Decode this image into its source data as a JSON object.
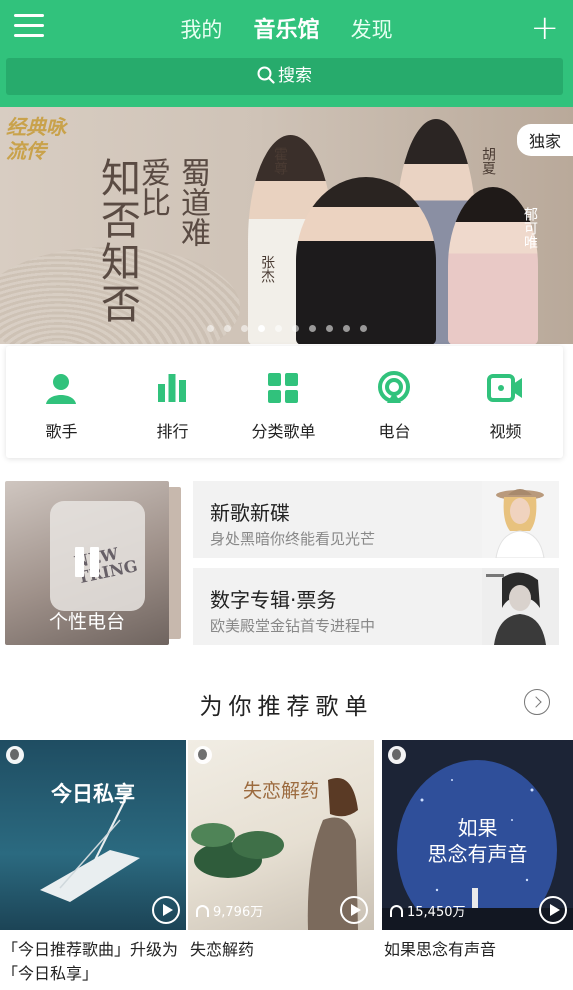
{
  "header": {
    "tabs": [
      {
        "label": "我的"
      },
      {
        "label": "音乐馆"
      },
      {
        "label": "发现"
      }
    ],
    "active_tab": "音乐馆",
    "plus_icon": "plus-icon",
    "menu_icon": "hamburger-menu-icon",
    "search": {
      "label": "搜索",
      "icon": "search-icon"
    },
    "colors": {
      "brand": "#31c27c",
      "search_bg": "#27ab6c"
    }
  },
  "banner": {
    "show_logo": "经典咏流传",
    "poem_lines": [
      "知否知否",
      "爱比",
      "蜀道难"
    ],
    "artists": [
      "霍尊",
      "胡夏",
      "张杰",
      "郁可唯"
    ],
    "exclusive_label": "独家",
    "page_count": 10,
    "active_page": 4
  },
  "shortcuts": [
    {
      "label": "歌手",
      "icon": "singer-icon"
    },
    {
      "label": "排行",
      "icon": "ranking-bars-icon"
    },
    {
      "label": "分类歌单",
      "icon": "category-grid-icon"
    },
    {
      "label": "电台",
      "icon": "radio-icon"
    },
    {
      "label": "视频",
      "icon": "video-camera-icon"
    }
  ],
  "personal_radio": {
    "title": "个性电台",
    "state_icon": "pause-icon",
    "shirt_text": "NEW TRING"
  },
  "features": [
    {
      "title": "新歌新碟",
      "subtitle": "身处黑暗你终能看见光芒"
    },
    {
      "title": "数字专辑·票务",
      "subtitle": "欧美殿堂金钻首专进程中"
    }
  ],
  "recommend": {
    "title": "为你推荐歌单",
    "more_icon": "chevron-right-circle-icon",
    "playlists": [
      {
        "cover_title": "今日私享",
        "name": "「今日推荐歌曲」升级为「今日私享」",
        "plays": ""
      },
      {
        "cover_title": "失恋解药",
        "name": "失恋解药",
        "plays": "9,796万"
      },
      {
        "cover_title": "如果思念有声音",
        "cover_title_line1": "如果",
        "cover_title_line2": "思念有声音",
        "name": "如果思念有声音",
        "plays": "15,450万"
      }
    ]
  }
}
